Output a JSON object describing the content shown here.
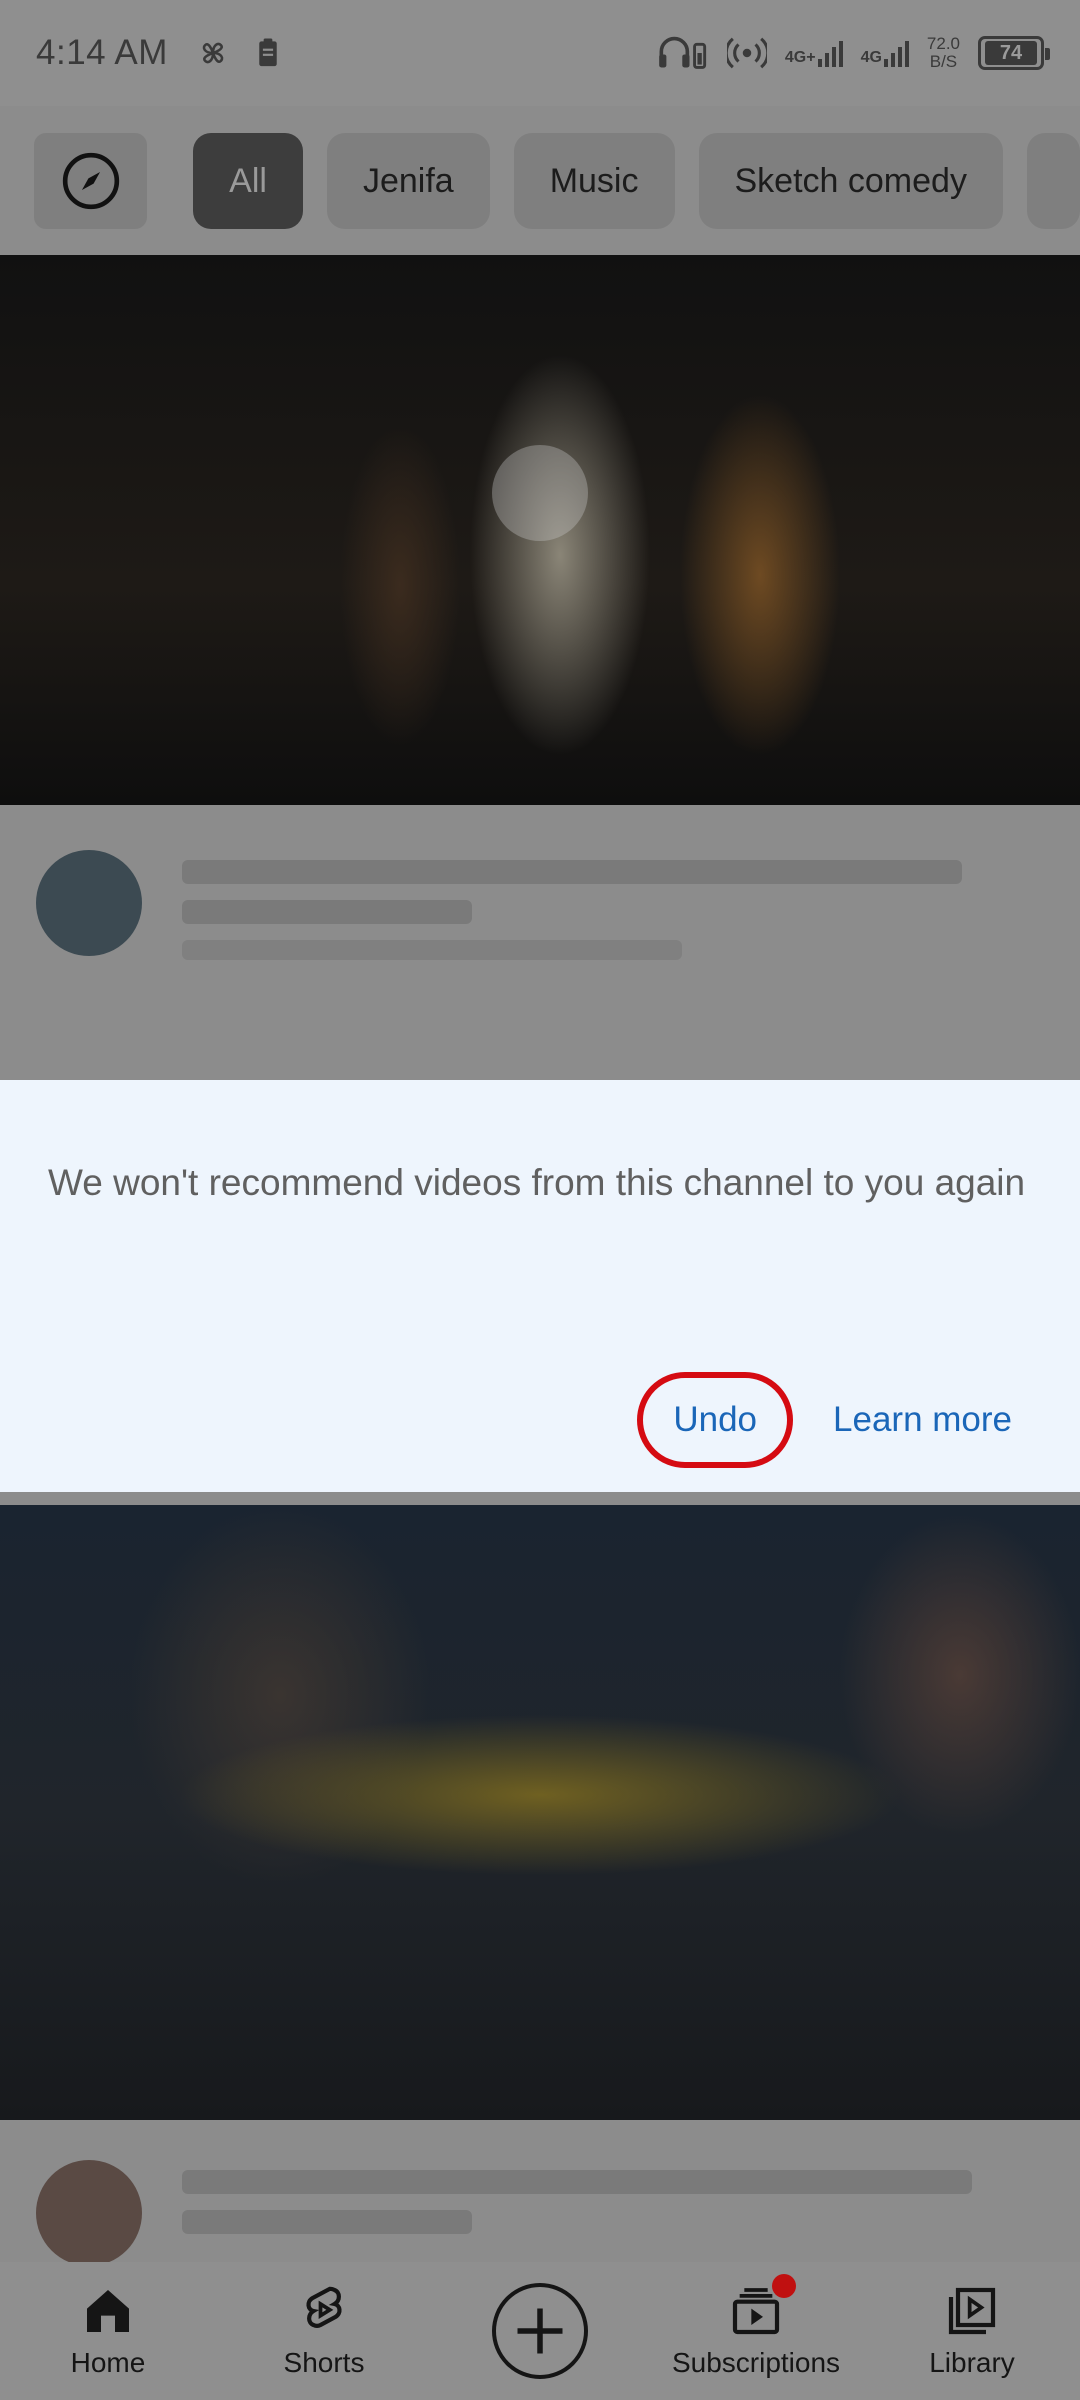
{
  "status_bar": {
    "time": "4:14 AM",
    "net_speed_value": "72.0",
    "net_speed_unit": "B/S",
    "network_1": "4G+",
    "network_2": "4G",
    "battery_level": "74"
  },
  "chips": {
    "items": [
      {
        "label": "All",
        "active": true
      },
      {
        "label": "Jenifa",
        "active": false
      },
      {
        "label": "Music",
        "active": false
      },
      {
        "label": "Sketch comedy",
        "active": false
      }
    ]
  },
  "notice": {
    "message": "We won't recommend videos from this channel to you again",
    "undo_label": "Undo",
    "learn_more_label": "Learn more",
    "highlight_color": "#d50b12",
    "link_color": "#1a66b8"
  },
  "bottom_nav": {
    "home_label": "Home",
    "shorts_label": "Shorts",
    "subscriptions_label": "Subscriptions",
    "library_label": "Library"
  },
  "icons": {
    "explore": "compass-icon",
    "home": "home-icon",
    "shorts": "shorts-icon",
    "create": "plus-icon",
    "subscriptions": "subscriptions-icon",
    "library": "library-icon"
  }
}
